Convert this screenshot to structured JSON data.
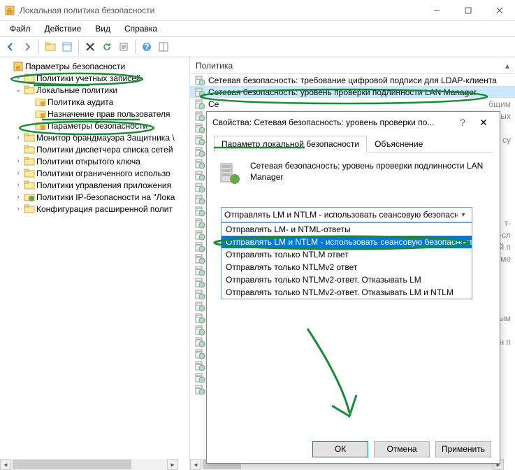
{
  "window": {
    "title": "Локальная политика безопасности"
  },
  "menu": {
    "file": "Файл",
    "action": "Действие",
    "view": "Вид",
    "help": "Справка"
  },
  "tree": {
    "root": "Параметры безопасности",
    "items": [
      "Политики учетных записей",
      "Локальные политики",
      "Монитор брандмауэра Защитника \\",
      "Политики диспетчера списка сетей",
      "Политики открытого ключа",
      "Политики ограниченного использо",
      "Политики управления приложения",
      "Политики IP-безопасности на \"Лока",
      "Конфигурация расширенной полит"
    ],
    "local_children": [
      "Политика аудита",
      "Назначение прав пользователя",
      "Параметры безопасности"
    ]
  },
  "list": {
    "header": "Политика",
    "rows": [
      "Сетевая безопасность: требование цифровой подписи для LDAP-клиента",
      "Сетевая безопасность: уровень проверки подлинности LAN Manager"
    ],
    "fragments": [
      "бщим",
      "ных",
      "",
      "су",
      "",
      "",
      "",
      "",
      "",
      "",
      "т-",
      "т-сл",
      "ій п",
      "еме",
      "",
      "",
      "",
      "",
      "ым",
      "",
      "н п",
      "",
      "",
      "",
      ""
    ],
    "partial": "Се"
  },
  "dialog": {
    "title": "Свойства: Сетевая безопасность: уровень проверки по...",
    "tabs": {
      "local": "Параметр локальной безопасности",
      "explain": "Объяснение"
    },
    "policy_name": "Сетевая безопасность: уровень проверки подлинности LAN Manager",
    "combo_selected": "Отправлять LM и NTLM - использовать сеансовую безопасность",
    "options": [
      "Отправлять LM- и NTML-ответы",
      "Отправлять LM и NTLM - использовать сеансовую безопасность NTL",
      "Отправлять только NTLM ответ",
      "Отправлять только NTLMv2 ответ",
      "Отправлять только NTLMv2-ответ. Отказывать LM",
      "Отправлять только NTLMv2-ответ. Отказывать LM и NTLM"
    ],
    "buttons": {
      "ok": "ОК",
      "cancel": "Отмена",
      "apply": "Применить"
    }
  }
}
